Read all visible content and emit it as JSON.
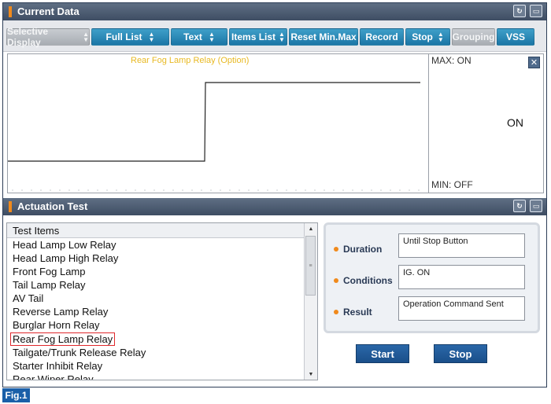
{
  "current_data": {
    "title": "Current Data",
    "retry_icon": "retry-icon",
    "window_icon": "window-icon"
  },
  "toolbar": {
    "selective_display": "Selective Display",
    "full_list": "Full List",
    "text": "Text",
    "items_list": "Items List",
    "reset_min_max": "Reset Min.Max",
    "record": "Record",
    "stop": "Stop",
    "grouping": "Grouping",
    "vss": "VSS"
  },
  "graph": {
    "series_label": "Rear Fog Lamp Relay (Option)",
    "max_label": "MAX: ON",
    "min_label": "MIN: OFF",
    "current_value": "ON",
    "close_icon": "close-icon",
    "series_color": "#e8b923"
  },
  "actuation": {
    "title": "Actuation Test",
    "list_header": "Test Items",
    "items": [
      "Head Lamp Low Relay",
      "Head Lamp High Relay",
      "Front Fog Lamp",
      "Tail Lamp Relay",
      "AV Tail",
      "Reverse Lamp Relay",
      "Burglar Horn Relay",
      "Rear Fog Lamp Relay",
      "Tailgate/Trunk Release Relay",
      "Starter Inhibit Relay",
      "Rear Wiper Relay"
    ],
    "selected_index": 7,
    "duration_label": "Duration",
    "duration_value": "Until Stop Button",
    "conditions_label": "Conditions",
    "conditions_value": "IG. ON",
    "result_label": "Result",
    "result_value": "Operation Command Sent",
    "start": "Start",
    "stop": "Stop"
  },
  "figure_label": "Fig.1",
  "colors": {
    "accent": "#1b76a6",
    "title_bar": "#4a5a70",
    "marker": "#f08a1c",
    "selection": "#e0282c"
  }
}
